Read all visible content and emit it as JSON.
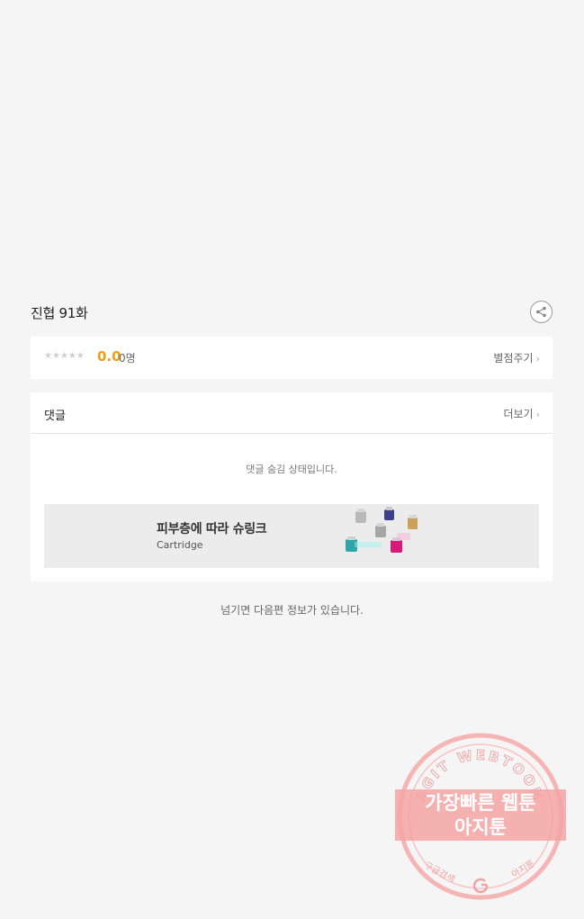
{
  "episode": {
    "title": "진협 91화"
  },
  "rating": {
    "stars": "★★★★★",
    "score": "0.0",
    "count": "0명",
    "rate_link": "별점주기"
  },
  "comments": {
    "title": "댓글",
    "more": "더보기",
    "hidden_message": "댓글 숨김 상태입니다."
  },
  "ad": {
    "title": "피부층에 따라 슈링크",
    "subtitle": "Cartridge"
  },
  "footer": {
    "next_info": "넘기면 다음편 정보가 있습니다."
  },
  "watermark": {
    "arc_text": "AGIT WEBTOON",
    "line1": "가장빠른 웹툰",
    "line2": "아지툰",
    "bottom_left": "구글검색",
    "bottom_right": "아지툰",
    "accent_color": "#f08a8a"
  },
  "icons": {
    "share": "share-icon",
    "chevron": "chevron-right-icon"
  }
}
